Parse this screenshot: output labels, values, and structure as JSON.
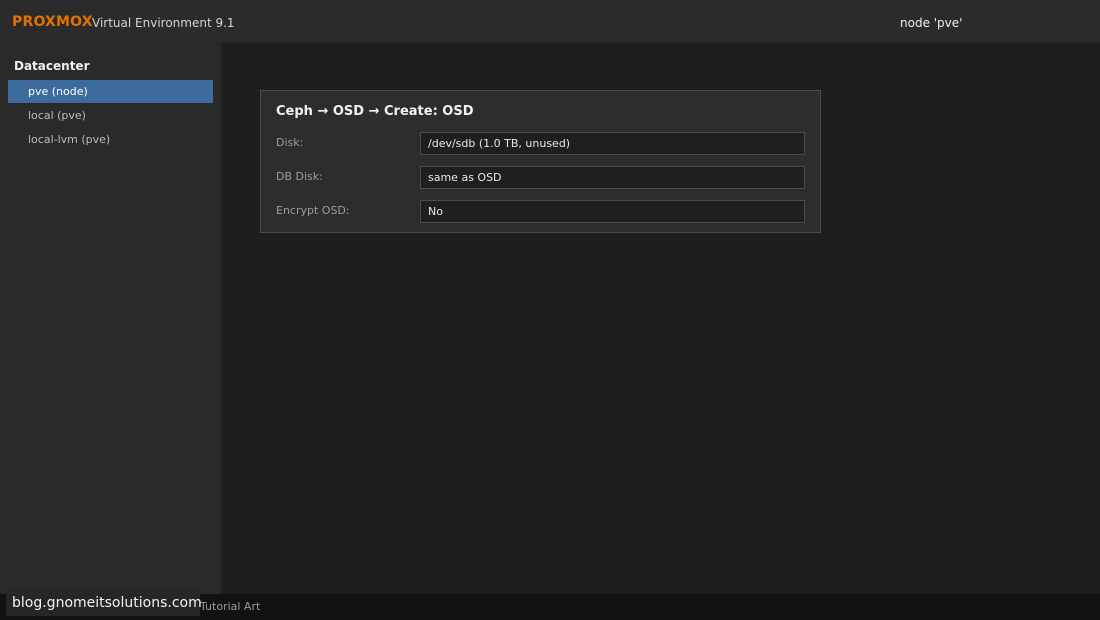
{
  "header": {
    "brand": "PROXMOX",
    "version": "Virtual Environment 9.1",
    "node_label": "node 'pve'"
  },
  "sidebar": {
    "title": "Datacenter",
    "items": [
      {
        "label": "pve (node)",
        "selected": true
      },
      {
        "label": "local (pve)",
        "selected": false
      },
      {
        "label": "local-lvm (pve)",
        "selected": false
      }
    ]
  },
  "dialog": {
    "title": "Ceph → OSD → Create: OSD",
    "fields": [
      {
        "label": "Disk:",
        "value": "/dev/sdb (1.0 TB, unused)"
      },
      {
        "label": "DB Disk:",
        "value": "same as OSD"
      },
      {
        "label": "Encrypt OSD:",
        "value": "No"
      }
    ]
  },
  "footer": {
    "text": "Tutorial Art"
  },
  "watermark": {
    "text": "blog.gnomeitsolutions.com"
  },
  "colors": {
    "brand": "#e57000",
    "selection": "#3e6b9e",
    "panel": "#2d2d2d",
    "background": "#1e1e1e"
  }
}
